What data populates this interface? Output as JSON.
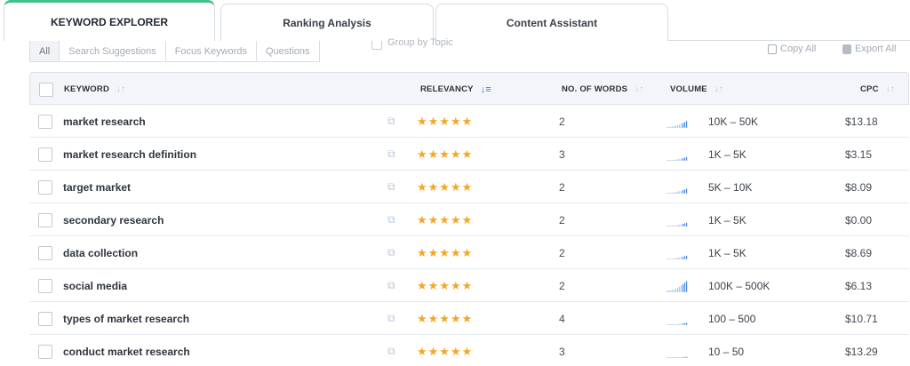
{
  "tabs": [
    {
      "label": "KEYWORD EXPLORER",
      "active": true
    },
    {
      "label": "Ranking Analysis",
      "active": false
    },
    {
      "label": "Content Assistant",
      "active": false
    }
  ],
  "filters": [
    "All",
    "Search Suggestions",
    "Focus Keywords",
    "Questions"
  ],
  "group_by_topic": "Group by Topic",
  "actions": {
    "copy_all": "Copy All",
    "export_all": "Export All"
  },
  "columns": {
    "keyword": "KEYWORD",
    "relevancy": "RELEVANCY",
    "words": "NO. OF WORDS",
    "volume": "VOLUME",
    "cpc": "CPC"
  },
  "icons": {
    "sort": "sort-arrows-icon",
    "sort_active": "sort-descending-icon",
    "external": "external-link-icon",
    "star": "star-icon",
    "copy": "copy-icon",
    "export": "export-icon"
  },
  "colors": {
    "accent": "#42c18a",
    "star": "#f5a623",
    "spark": "#4a90e2",
    "sort_active": "#3f7ee6"
  },
  "rows": [
    {
      "keyword": "market research",
      "stars": "★★★★★",
      "words": "2",
      "volume": "10K – 50K",
      "cpc": "$13.18",
      "spark_level": 0.55
    },
    {
      "keyword": "market research definition",
      "stars": "★★★★★",
      "words": "3",
      "volume": "1K – 5K",
      "cpc": "$3.15",
      "spark_level": 0.3
    },
    {
      "keyword": "target market",
      "stars": "★★★★★",
      "words": "2",
      "volume": "5K – 10K",
      "cpc": "$8.09",
      "spark_level": 0.4
    },
    {
      "keyword": "secondary research",
      "stars": "★★★★★",
      "words": "2",
      "volume": "1K – 5K",
      "cpc": "$0.00",
      "spark_level": 0.3
    },
    {
      "keyword": "data collection",
      "stars": "★★★★★",
      "words": "2",
      "volume": "1K – 5K",
      "cpc": "$8.69",
      "spark_level": 0.3
    },
    {
      "keyword": "social media",
      "stars": "★★★★★",
      "words": "2",
      "volume": "100K – 500K",
      "cpc": "$6.13",
      "spark_level": 0.9
    },
    {
      "keyword": "types of market research",
      "stars": "★★★★★",
      "words": "4",
      "volume": "100 – 500",
      "cpc": "$10.71",
      "spark_level": 0.2
    },
    {
      "keyword": "conduct market research",
      "stars": "★★★★★",
      "words": "3",
      "volume": "10 – 50",
      "cpc": "$13.29",
      "spark_level": 0.1
    }
  ]
}
